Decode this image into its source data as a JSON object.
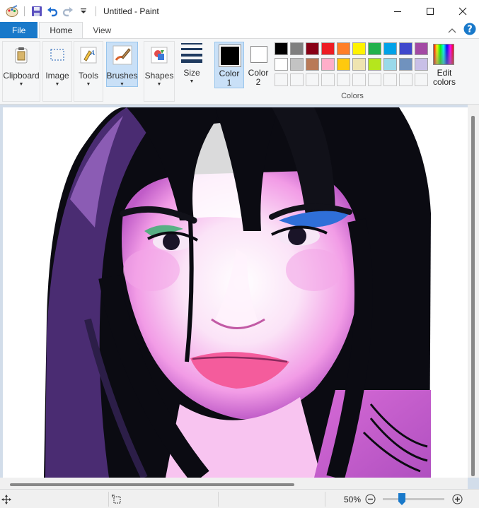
{
  "window": {
    "title": "Untitled - Paint",
    "controls": {
      "minimize": "minimize-icon",
      "maximize": "maximize-icon",
      "close": "close-icon"
    }
  },
  "quick_access": [
    "paint-app-icon",
    "save-icon",
    "undo-icon",
    "redo-icon",
    "customize-dropdown-icon"
  ],
  "tabs": [
    {
      "label": "File"
    },
    {
      "label": "Home"
    },
    {
      "label": "View"
    }
  ],
  "ribbon": {
    "clipboard": "Clipboard",
    "image": "Image",
    "tools": "Tools",
    "brushes": "Brushes",
    "shapes": "Shapes",
    "size": "Size",
    "color1_line1": "Color",
    "color1_line2": "1",
    "color2_line1": "Color",
    "color2_line2": "2",
    "colors_group": "Colors",
    "edit_colors_line1": "Edit",
    "edit_colors_line2": "colors",
    "color1_value": "#000000",
    "color2_value": "#ffffff",
    "palette_row1": [
      "#000000",
      "#7f7f7f",
      "#880015",
      "#ed1c24",
      "#ff7f27",
      "#fff200",
      "#22b14c",
      "#00a2e8",
      "#3f48cc",
      "#a349a4"
    ],
    "palette_row2": [
      "#ffffff",
      "#c3c3c3",
      "#b97a57",
      "#ffaec9",
      "#ffc90e",
      "#efe4b0",
      "#b5e61d",
      "#99d9ea",
      "#7092be",
      "#c8bfe7"
    ]
  },
  "status": {
    "zoom": "50%",
    "zoom_level": 0.28
  },
  "canvas": {
    "image": "pop-art-portrait"
  }
}
